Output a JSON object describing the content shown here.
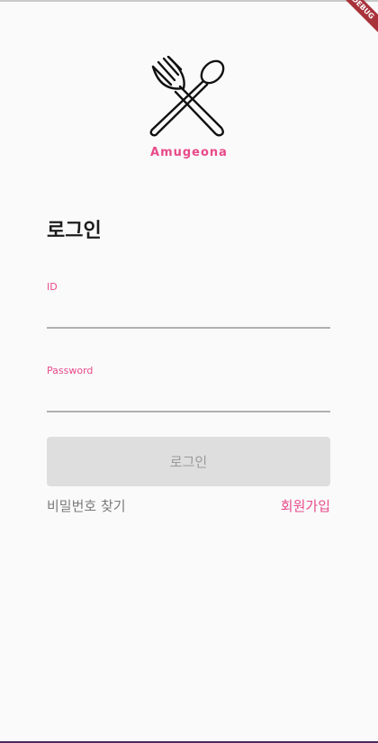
{
  "debug_banner": "DEBUG",
  "brand": {
    "name": "Amugeona",
    "color": "#e84a8a",
    "logo_icon": "fork-and-spoon-icon"
  },
  "login": {
    "title": "로그인",
    "id_label": "ID",
    "id_value": "",
    "password_label": "Password",
    "password_value": "",
    "submit_label": "로그인",
    "find_password": "비밀번호 찾기",
    "signup": "회원가입"
  }
}
